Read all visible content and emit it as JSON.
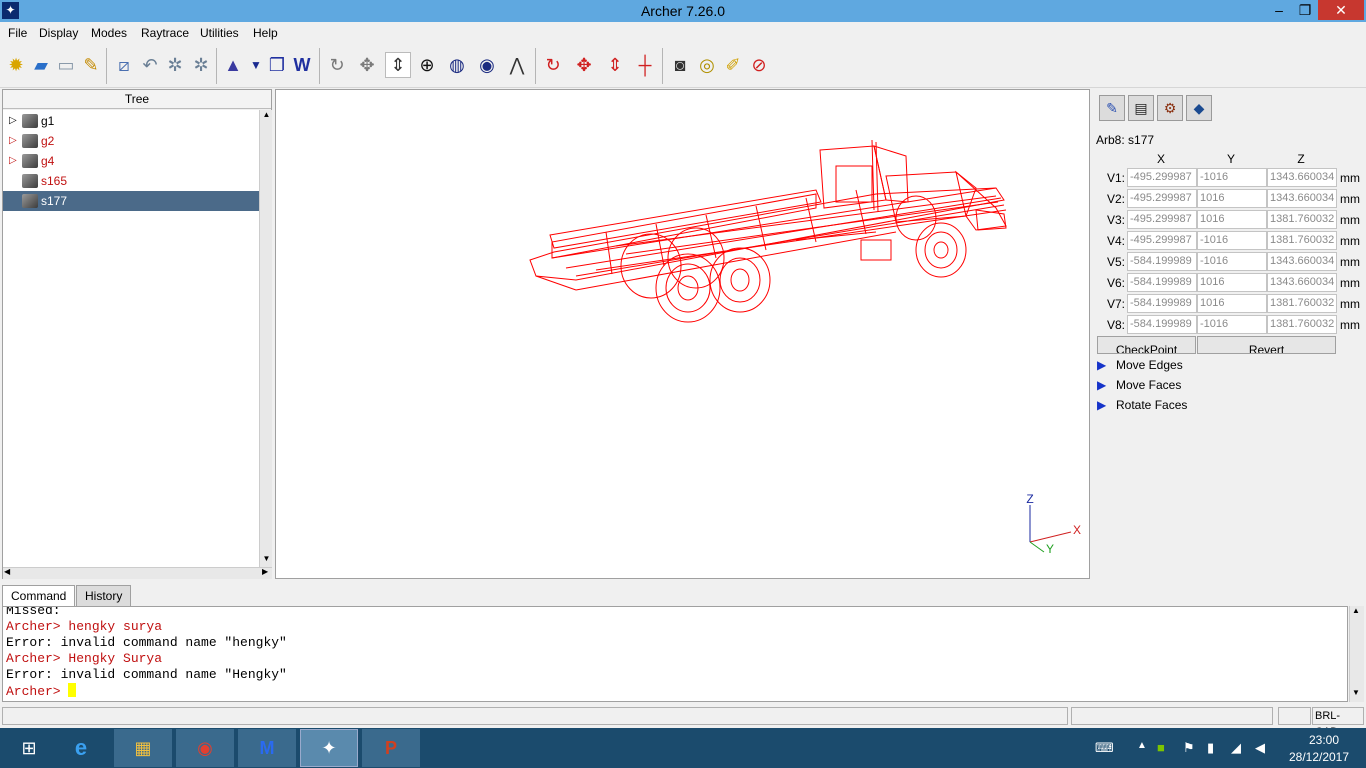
{
  "window": {
    "title": "Archer 7.26.0",
    "app_icon": "archer-icon",
    "minimize": "–",
    "maximize": "❐",
    "close": "✕"
  },
  "menu": [
    "File",
    "Display",
    "Modes",
    "Raytrace",
    "Utilities",
    "Help"
  ],
  "toolbar": {
    "icons": [
      "new-db-icon",
      "open-icon",
      "save-icon",
      "preferences-icon",
      "edit-icon",
      "undo-icon",
      "redo-icon",
      "reload-icon",
      "wizard-icon",
      "dropdown-icon",
      "primitive-icon",
      "comb-icon",
      "rotate-icon",
      "translate-icon",
      "scale-icon",
      "center-icon",
      "sphere-view-icon",
      "cube-view-icon",
      "measure-icon",
      "rotate-edit-icon",
      "translate-edit-icon",
      "scale-edit-icon",
      "center-edit-icon",
      "camera-icon",
      "raytrace-icon",
      "clean-icon",
      "stop-icon"
    ]
  },
  "tree": {
    "header": "Tree",
    "items": [
      {
        "label": "g1",
        "expandable": true,
        "color": "#000000",
        "selected": false
      },
      {
        "label": "g2",
        "expandable": true,
        "color": "#c01010",
        "selected": false
      },
      {
        "label": "g4",
        "expandable": true,
        "color": "#c01010",
        "selected": false
      },
      {
        "label": "s165",
        "expandable": false,
        "color": "#c01010",
        "selected": false
      },
      {
        "label": "s177",
        "expandable": false,
        "color": "#ffffff",
        "selected": true
      }
    ]
  },
  "viewport": {
    "wireframe_color": "#ff0000",
    "axes": {
      "z": "Z",
      "x": "X",
      "y": "Y"
    }
  },
  "edit_panel": {
    "object_title": "Arb8: s177",
    "columns": [
      "X",
      "Y",
      "Z"
    ],
    "unit": "mm",
    "vertices": [
      {
        "label": "V1:",
        "x": "-495.299987",
        "y": "-1016",
        "z": "1343.660034"
      },
      {
        "label": "V2:",
        "x": "-495.299987",
        "y": "1016",
        "z": "1343.660034"
      },
      {
        "label": "V3:",
        "x": "-495.299987",
        "y": "1016",
        "z": "1381.760032"
      },
      {
        "label": "V4:",
        "x": "-495.299987",
        "y": "-1016",
        "z": "1381.760032"
      },
      {
        "label": "V5:",
        "x": "-584.199989",
        "y": "-1016",
        "z": "1343.660034"
      },
      {
        "label": "V6:",
        "x": "-584.199989",
        "y": "1016",
        "z": "1343.660034"
      },
      {
        "label": "V7:",
        "x": "-584.199989",
        "y": "1016",
        "z": "1381.760032"
      },
      {
        "label": "V8:",
        "x": "-584.199989",
        "y": "-1016",
        "z": "1381.760032"
      }
    ],
    "buttons": {
      "checkpoint": "CheckPoint",
      "revert": "Revert"
    },
    "operations": [
      "Move Edges",
      "Move Faces",
      "Rotate Faces"
    ]
  },
  "command": {
    "tabs": [
      "Command",
      "History"
    ],
    "lines": [
      {
        "text": "Missed:",
        "color": "black"
      },
      {
        "text": "Archer> hengky surya",
        "color": "red"
      },
      {
        "text": "Error: invalid command name \"hengky\"",
        "color": "black"
      },
      {
        "text": "Archer> Hengky Surya",
        "color": "red"
      },
      {
        "text": "Error: invalid command name \"Hengky\"",
        "color": "black"
      }
    ],
    "prompt": "Archer> "
  },
  "status": {
    "right_label": "BRL-CAD"
  },
  "taskbar": {
    "apps": [
      "windows-start-icon",
      "internet-explorer-icon",
      "file-explorer-icon",
      "chrome-icon",
      "malwarebytes-icon",
      "archer-icon",
      "powerpoint-icon"
    ],
    "time": "23:00",
    "date": "28/12/2017"
  }
}
